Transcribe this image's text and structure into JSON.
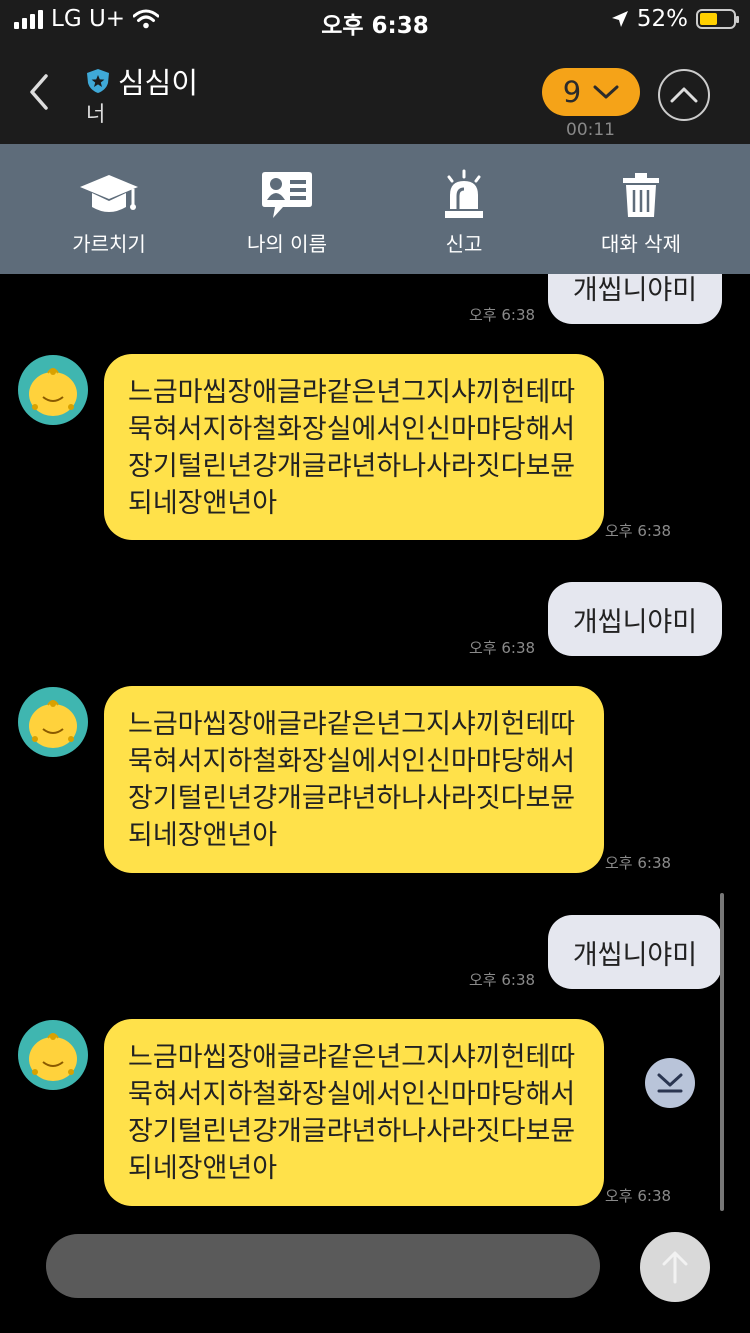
{
  "status_bar": {
    "carrier": "LG U+",
    "time": "오후 6:38",
    "battery_text": "52%",
    "battery_level": 0.52,
    "battery_color": "#ffd000"
  },
  "header": {
    "title": "심심이",
    "subtitle": "너",
    "badge_count": "9",
    "timer": "00:11",
    "back_icon": "chevron-left-icon",
    "up_icon": "chevron-up-icon"
  },
  "actions": [
    {
      "label": "가르치기",
      "icon": "graduation-cap-icon"
    },
    {
      "label": "나의 이름",
      "icon": "id-card-icon"
    },
    {
      "label": "신고",
      "icon": "siren-icon"
    },
    {
      "label": "대화 삭제",
      "icon": "trash-icon"
    }
  ],
  "messages": [
    {
      "type": "out",
      "text": "개씹니야미",
      "time": "오후 6:38"
    },
    {
      "type": "in",
      "text": "느금마씹장애글랴같은년그지샤끼헌테따묵혀서지하철화장실에서인신마먀당해서장기털린년걍개글랴년하나사라짓다보뮨되네장앤년아",
      "time": "오후 6:38"
    },
    {
      "type": "out",
      "text": "개씹니야미",
      "time": "오후 6:38"
    },
    {
      "type": "in",
      "text": "느금마씹장애글랴같은년그지샤끼헌테따묵혀서지하철화장실에서인신마먀당해서장기털린년걍개글랴년하나사라짓다보뮨되네장앤년아",
      "time": "오후 6:38"
    },
    {
      "type": "out",
      "text": "개씹니야미",
      "time": "오후 6:38"
    },
    {
      "type": "in",
      "text": "느금마씹장애글랴같은년그지샤끼헌테따묵혀서지하철화장실에서인신마먀당해서장기털린년걍개글랴년하나사라짓다보뮨되네장앤년아",
      "time": "오후 6:38"
    }
  ],
  "colors": {
    "incoming_bubble": "#ffe14a",
    "outgoing_bubble": "#e5e7ef",
    "action_bar": "#5e6c7a",
    "badge": "#f5a318"
  },
  "input": {
    "placeholder": "",
    "value": ""
  },
  "icons": {
    "scroll_down": "scroll-down-icon",
    "send": "send-arrow-icon"
  }
}
